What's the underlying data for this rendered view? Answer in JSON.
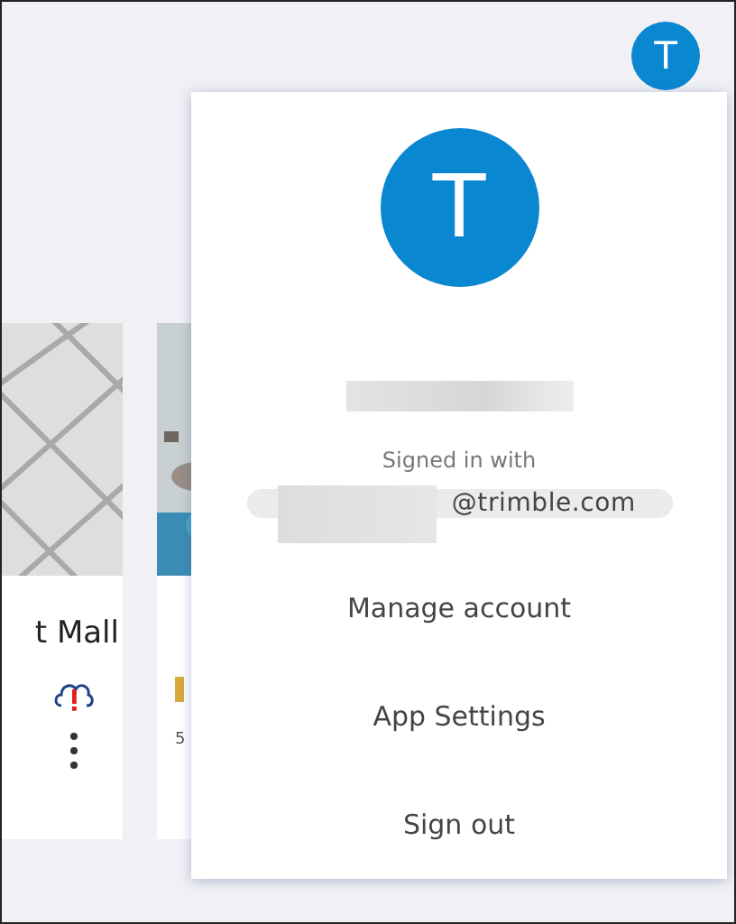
{
  "header": {
    "avatar_initial": "T"
  },
  "cards": [
    {
      "title": "t Mall",
      "kind": "full"
    },
    {
      "detail": "5",
      "kind": "partial"
    }
  ],
  "account_menu": {
    "avatar_initial": "T",
    "signed_in_label": "Signed in with",
    "email": "@trimble.com",
    "items": [
      {
        "label": "Manage account"
      },
      {
        "label": "App Settings"
      },
      {
        "label": "Sign out"
      }
    ]
  }
}
